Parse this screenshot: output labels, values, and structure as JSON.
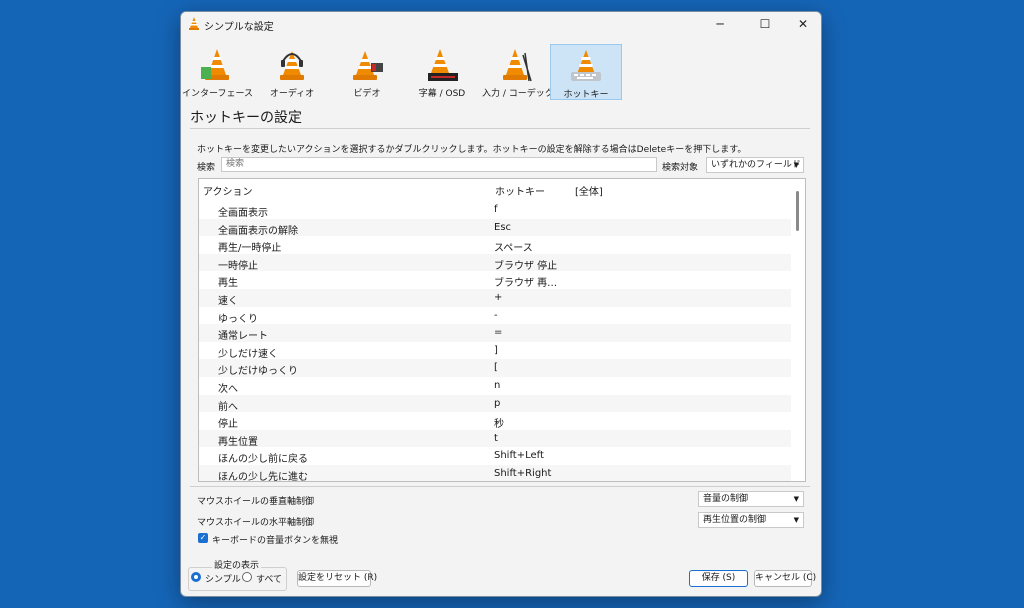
{
  "window": {
    "title": "シンプルな設定"
  },
  "categories": [
    {
      "label": "インターフェース"
    },
    {
      "label": "オーディオ"
    },
    {
      "label": "ビデオ"
    },
    {
      "label": "字幕 / OSD"
    },
    {
      "label": "入力 / コーデック"
    },
    {
      "label": "ホットキー",
      "selected": true
    }
  ],
  "section": {
    "title": "ホットキーの設定"
  },
  "instructions": "ホットキーを変更したいアクションを選択するかダブルクリックします。ホットキーの設定を解除する場合はDeleteキーを押下します。",
  "search": {
    "label": "検索",
    "placeholder": "検索",
    "filter_label": "検索対象",
    "filter_value": "いずれかのフィールド"
  },
  "table": {
    "headers": {
      "action": "アクション",
      "hotkey": "ホットキー",
      "global": "[全体]"
    },
    "rows": [
      {
        "action": "全画面表示",
        "hotkey": "f"
      },
      {
        "action": "全画面表示の解除",
        "hotkey": "Esc"
      },
      {
        "action": "再生/一時停止",
        "hotkey": "スペース"
      },
      {
        "action": "一時停止",
        "hotkey": "ブラウザ 停止"
      },
      {
        "action": "再生",
        "hotkey": "ブラウザ 再…"
      },
      {
        "action": "速く",
        "hotkey": "+"
      },
      {
        "action": "ゆっくり",
        "hotkey": "-"
      },
      {
        "action": "通常レート",
        "hotkey": "="
      },
      {
        "action": "少しだけ速く",
        "hotkey": "]"
      },
      {
        "action": "少しだけゆっくり",
        "hotkey": "["
      },
      {
        "action": "次へ",
        "hotkey": "n"
      },
      {
        "action": "前へ",
        "hotkey": "p"
      },
      {
        "action": "停止",
        "hotkey": "秒"
      },
      {
        "action": "再生位置",
        "hotkey": "t"
      },
      {
        "action": "ほんの少し前に戻る",
        "hotkey": "Shift+Left"
      },
      {
        "action": "ほんの少し先に進む",
        "hotkey": "Shift+Right"
      }
    ]
  },
  "options": {
    "vertical_wheel_label": "マウスホイールの垂直軸制御",
    "vertical_wheel_value": "音量の制御",
    "horizontal_wheel_label": "マウスホイールの水平軸制御",
    "horizontal_wheel_value": "再生位置の制御",
    "ignore_volume_keys_label": "キーボードの音量ボタンを無視",
    "ignore_volume_keys_checked": true
  },
  "display": {
    "legend": "設定の表示",
    "simple": "シンプル",
    "all": "すべて",
    "selected": "simple"
  },
  "buttons": {
    "reset": "設定をリセット (R)",
    "save": "保存 (S)",
    "cancel": "キャンセル (C)"
  },
  "colors": {
    "desktop": "#1565b7",
    "accent": "#1a6fd1",
    "selected_tab": "#cde4f7",
    "cone_orange": "#f08a00"
  }
}
